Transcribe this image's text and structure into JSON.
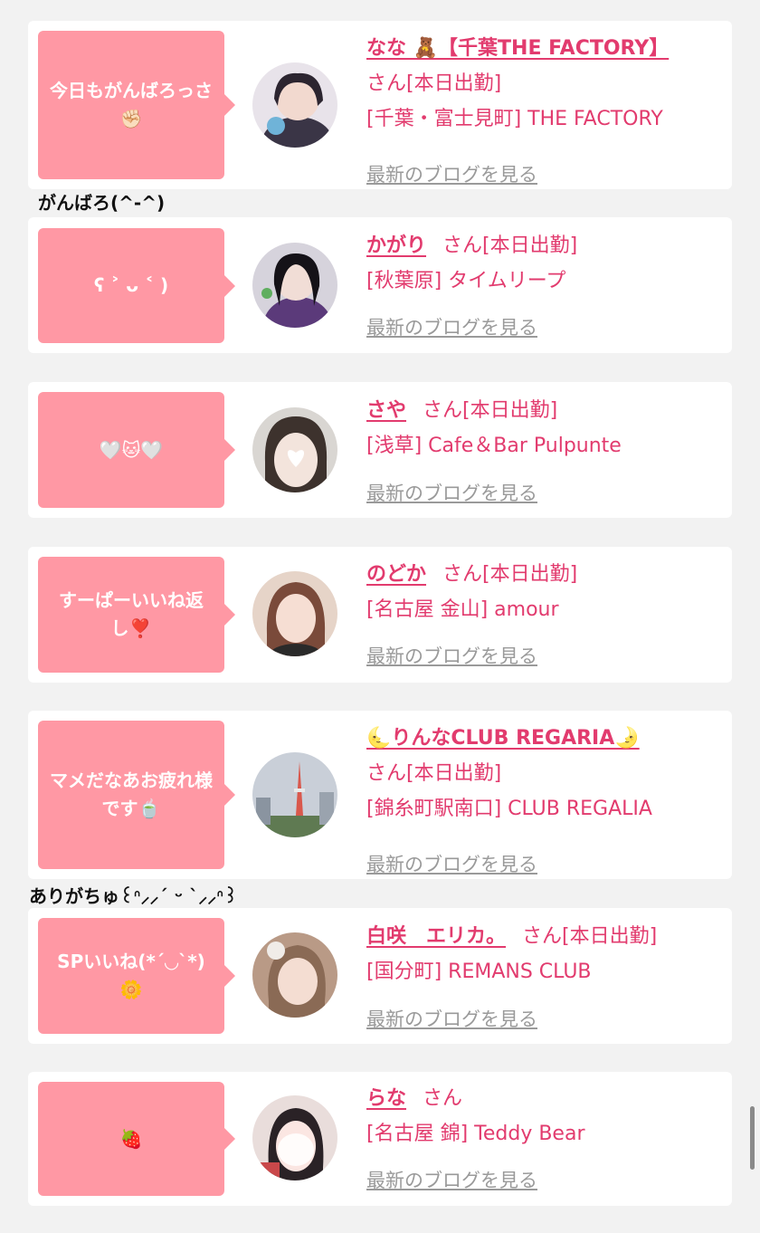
{
  "entries": [
    {
      "comment": "今日もがんばろっさ✊🏻",
      "name": "なな 🧸【千葉THE FACTORY】",
      "san_label": "さん[本日出勤]",
      "shop": "[千葉・富士見町] THE FACTORY",
      "blog_link": "最新のブログを見る",
      "avatar_color": "#3a3546"
    },
    {
      "comment": "ʕ ˃ ᴗ ˂ )",
      "name": "かがり",
      "san_label": "さん[本日出勤]",
      "shop": "[秋葉原] タイムリープ",
      "blog_link": "最新のブログを見る",
      "avatar_color": "#4a3a60"
    },
    {
      "comment": "🤍🐱🤍",
      "name": "さや",
      "san_label": "さん[本日出勤]",
      "shop": "[浅草] Cafe＆Bar Pulpunte",
      "blog_link": "最新のブログを見る",
      "avatar_color": "#c9c4c0"
    },
    {
      "comment": "すーぱーいいね返し❣️",
      "name": "のどか",
      "san_label": "さん[本日出勤]",
      "shop": "[名古屋 金山] amour",
      "blog_link": "最新のブログを見る",
      "avatar_color": "#7a4a3a"
    },
    {
      "comment": "マメだなあお疲れ様です🍵",
      "name": "🌜りんなCLUB REGARIA🌛",
      "san_label": "さん[本日出勤]",
      "shop": "[錦糸町駅南口] CLUB REGALIA",
      "blog_link": "最新のブログを見る",
      "avatar_color": "#aab3c0"
    },
    {
      "comment": "SPいいね(*´◡`*)🌼",
      "name": "白咲　エリカ。",
      "san_label": "さん[本日出勤]",
      "shop": "[国分町] REMANS CLUB",
      "blog_link": "最新のブログを見る",
      "avatar_color": "#8a6a55"
    },
    {
      "comment": "🍓",
      "name": "らな",
      "san_label": "さん",
      "shop": "[名古屋 錦] Teddy Bear",
      "blog_link": "最新のブログを見る",
      "avatar_color": "#d8b0b0"
    }
  ],
  "replies": {
    "r1": "がんばろ(^-^)",
    "r2": "ありがちゅ꒰ᐢ⸝⸝´ ᵕ `⸝⸝ᐢ꒱"
  },
  "colors": {
    "accent": "#e23b6e",
    "bubble": "#ff98a4",
    "background": "#f2f2f2"
  }
}
